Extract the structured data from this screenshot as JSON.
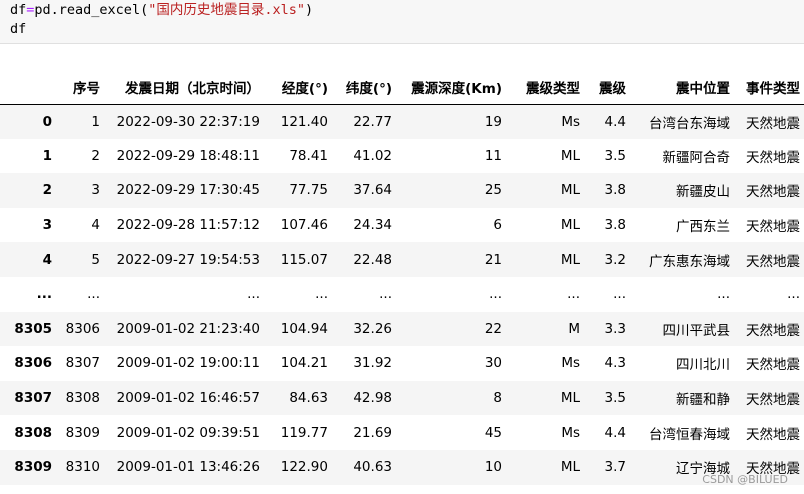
{
  "code": {
    "line1_var": "df",
    "line1_op": "=",
    "line1_call": "pd.read_excel(",
    "line1_arg": "\"国内历史地震目录.xls\"",
    "line1_close": ")",
    "line2": "df"
  },
  "table": {
    "columns": [
      "",
      "序号",
      "发震日期（北京时间）",
      "经度(°)",
      "纬度(°)",
      "震源深度(Km)",
      "震级类型",
      "震级",
      "震中位置",
      "事件类型"
    ],
    "rows": [
      [
        "0",
        "1",
        "2022-09-30 22:37:19",
        "121.40",
        "22.77",
        "19",
        "Ms",
        "4.4",
        "台湾台东海域",
        "天然地震"
      ],
      [
        "1",
        "2",
        "2022-09-29 18:48:11",
        "78.41",
        "41.02",
        "11",
        "ML",
        "3.5",
        "新疆阿合奇",
        "天然地震"
      ],
      [
        "2",
        "3",
        "2022-09-29 17:30:45",
        "77.75",
        "37.64",
        "25",
        "ML",
        "3.8",
        "新疆皮山",
        "天然地震"
      ],
      [
        "3",
        "4",
        "2022-09-28 11:57:12",
        "107.46",
        "24.34",
        "6",
        "ML",
        "3.8",
        "广西东兰",
        "天然地震"
      ],
      [
        "4",
        "5",
        "2022-09-27 19:54:53",
        "115.07",
        "22.48",
        "21",
        "ML",
        "3.2",
        "广东惠东海域",
        "天然地震"
      ],
      [
        "...",
        "...",
        "...",
        "...",
        "...",
        "...",
        "...",
        "...",
        "...",
        "..."
      ],
      [
        "8305",
        "8306",
        "2009-01-02 21:23:40",
        "104.94",
        "32.26",
        "22",
        "M",
        "3.3",
        "四川平武县",
        "天然地震"
      ],
      [
        "8306",
        "8307",
        "2009-01-02 19:00:11",
        "104.21",
        "31.92",
        "30",
        "Ms",
        "4.3",
        "四川北川",
        "天然地震"
      ],
      [
        "8307",
        "8308",
        "2009-01-02 16:46:57",
        "84.63",
        "42.98",
        "8",
        "ML",
        "3.5",
        "新疆和静",
        "天然地震"
      ],
      [
        "8308",
        "8309",
        "2009-01-02 09:39:51",
        "119.77",
        "21.69",
        "45",
        "Ms",
        "4.4",
        "台湾恒春海域",
        "天然地震"
      ],
      [
        "8309",
        "8310",
        "2009-01-01 13:46:26",
        "122.90",
        "40.63",
        "10",
        "ML",
        "3.7",
        "辽宁海城",
        "天然地震"
      ]
    ]
  },
  "watermark": "CSDN @BILUED"
}
